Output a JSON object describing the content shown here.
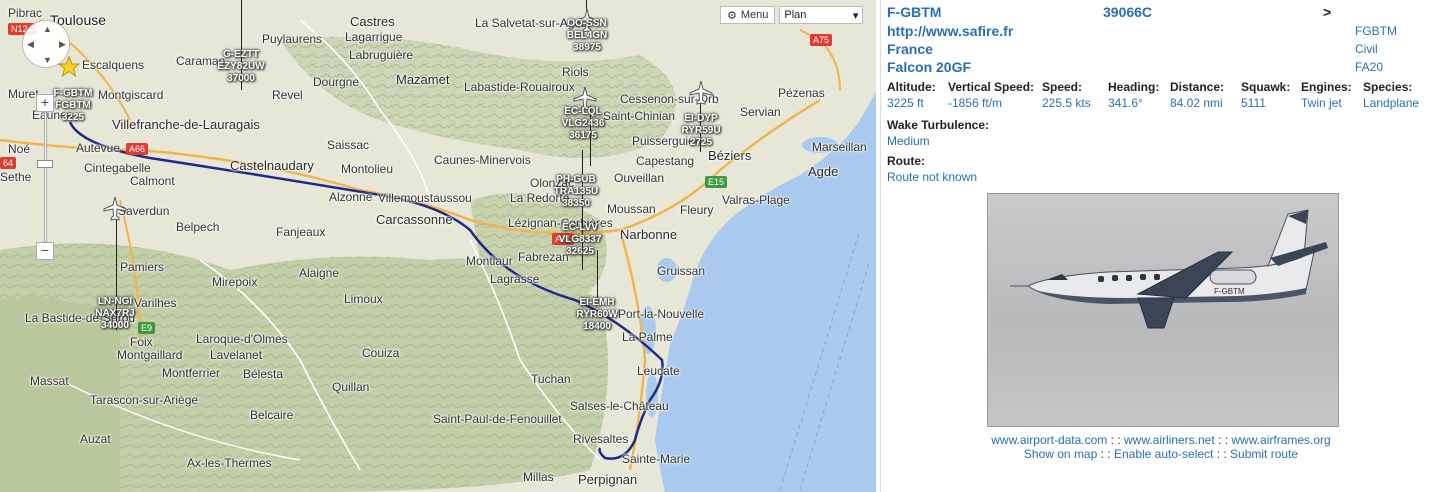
{
  "map": {
    "menu_label": "Menu",
    "menu_icon": "gear-icon",
    "map_type_value": "Plan",
    "zoom_in_label": "+",
    "zoom_out_label": "−",
    "places": [
      {
        "id": "toulouse",
        "name": "Toulouse",
        "size": "big"
      },
      {
        "id": "pibrac",
        "name": "Pibrac",
        "size": "small"
      },
      {
        "id": "castres",
        "name": "Castres",
        "size": "mid"
      },
      {
        "id": "lasalvetat",
        "name": "La Salvetat-sur-Agout",
        "size": "small"
      },
      {
        "id": "puylaurens",
        "name": "Puylaurens",
        "size": "small"
      },
      {
        "id": "lagarrigue",
        "name": "Lagarrigue",
        "size": "small"
      },
      {
        "id": "labruguiere",
        "name": "Labruguière",
        "size": "small"
      },
      {
        "id": "escalquens",
        "name": "Escalquens",
        "size": "small"
      },
      {
        "id": "caraman",
        "name": "Caraman",
        "size": "small"
      },
      {
        "id": "montgiscard",
        "name": "Montgiscard",
        "size": "small"
      },
      {
        "id": "revel",
        "name": "Revel",
        "size": "small"
      },
      {
        "id": "dourgne",
        "name": "Dourgne",
        "size": "small"
      },
      {
        "id": "mazamet",
        "name": "Mazamet",
        "size": "mid"
      },
      {
        "id": "labastide",
        "name": "Labastide-Rouairoux",
        "size": "small"
      },
      {
        "id": "riols",
        "name": "Riols",
        "size": "small"
      },
      {
        "id": "cessenon",
        "name": "Cessenon-sur-Orb",
        "size": "small"
      },
      {
        "id": "servian",
        "name": "Servian",
        "size": "small"
      },
      {
        "id": "pezenas",
        "name": "Pézenas",
        "size": "small"
      },
      {
        "id": "villefranche",
        "name": "Villefranche-de-Lauragais",
        "size": "mid"
      },
      {
        "id": "saintchinian",
        "name": "Saint-Chinian",
        "size": "small"
      },
      {
        "id": "puisserguier",
        "name": "Puisserguier",
        "size": "small"
      },
      {
        "id": "beziers",
        "name": "Béziers",
        "size": "mid"
      },
      {
        "id": "saissac",
        "name": "Saissac",
        "size": "small"
      },
      {
        "id": "caunes",
        "name": "Caunes-Minervois",
        "size": "small"
      },
      {
        "id": "capestang",
        "name": "Capestang",
        "size": "small"
      },
      {
        "id": "marseillan",
        "name": "Marseillan",
        "size": "small"
      },
      {
        "id": "castelnaudary",
        "name": "Castelnaudary",
        "size": "mid"
      },
      {
        "id": "montolieu",
        "name": "Montolieu",
        "size": "small"
      },
      {
        "id": "autevue",
        "name": "Autevue",
        "size": "small"
      },
      {
        "id": "cintegabelle",
        "name": "Cintegabelle",
        "size": "small"
      },
      {
        "id": "calmont",
        "name": "Calmont",
        "size": "small"
      },
      {
        "id": "olonzac",
        "name": "Olonzac",
        "size": "small"
      },
      {
        "id": "ouveillan",
        "name": "Ouveillan",
        "size": "small"
      },
      {
        "id": "agde",
        "name": "Agde",
        "size": "mid"
      },
      {
        "id": "alzonne",
        "name": "Alzonne",
        "size": "small"
      },
      {
        "id": "villemoustaussou",
        "name": "Villemoustaussou",
        "size": "small"
      },
      {
        "id": "laredorte",
        "name": "La Redorte",
        "size": "small"
      },
      {
        "id": "valras",
        "name": "Valras-Plage",
        "size": "small"
      },
      {
        "id": "saverdun",
        "name": "Saverdun",
        "size": "small"
      },
      {
        "id": "carcassonne",
        "name": "Carcassonne",
        "size": "mid"
      },
      {
        "id": "lezignan",
        "name": "Lézignan-Corbières",
        "size": "small"
      },
      {
        "id": "fleury",
        "name": "Fleury",
        "size": "small"
      },
      {
        "id": "belpech",
        "name": "Belpech",
        "size": "small"
      },
      {
        "id": "fanjeaux",
        "name": "Fanjeaux",
        "size": "small"
      },
      {
        "id": "moussan",
        "name": "Moussan",
        "size": "small"
      },
      {
        "id": "narbonne",
        "name": "Narbonne",
        "size": "mid"
      },
      {
        "id": "montlaur",
        "name": "Montlaur",
        "size": "small"
      },
      {
        "id": "fabrezan",
        "name": "Fabrezan",
        "size": "small"
      },
      {
        "id": "gruissan",
        "name": "Gruissan",
        "size": "small"
      },
      {
        "id": "pamiers",
        "name": "Pamiers",
        "size": "small"
      },
      {
        "id": "mirepoix",
        "name": "Mirepoix",
        "size": "small"
      },
      {
        "id": "alaigne",
        "name": "Alaigne",
        "size": "small"
      },
      {
        "id": "lagrasse",
        "name": "Lagrasse",
        "size": "small"
      },
      {
        "id": "limoux",
        "name": "Limoux",
        "size": "small"
      },
      {
        "id": "portlanouvelle",
        "name": "Port-la-Nouvelle",
        "size": "small"
      },
      {
        "id": "labastidedeser",
        "name": "La Bastide-de-Sérou",
        "size": "small"
      },
      {
        "id": "varilhes",
        "name": "Varilhes",
        "size": "small"
      },
      {
        "id": "foix",
        "name": "Foix",
        "size": "small"
      },
      {
        "id": "laroque",
        "name": "Laroque-d'Olmes",
        "size": "small"
      },
      {
        "id": "lapalme",
        "name": "La Palme",
        "size": "small"
      },
      {
        "id": "montgaillard",
        "name": "Montgaillard",
        "size": "small"
      },
      {
        "id": "lavelanet",
        "name": "Lavelanet",
        "size": "small"
      },
      {
        "id": "couiza",
        "name": "Couiza",
        "size": "small"
      },
      {
        "id": "massat",
        "name": "Massat",
        "size": "small"
      },
      {
        "id": "montferrier",
        "name": "Montferrier",
        "size": "small"
      },
      {
        "id": "belesta",
        "name": "Bélesta",
        "size": "small"
      },
      {
        "id": "leucate",
        "name": "Leucate",
        "size": "small"
      },
      {
        "id": "tarascon",
        "name": "Tarascon-sur-Ariège",
        "size": "small"
      },
      {
        "id": "quillan",
        "name": "Quillan",
        "size": "small"
      },
      {
        "id": "tuchan",
        "name": "Tuchan",
        "size": "small"
      },
      {
        "id": "salses",
        "name": "Salses-le-Château",
        "size": "small"
      },
      {
        "id": "belcaire",
        "name": "Belcaire",
        "size": "small"
      },
      {
        "id": "saintpaul",
        "name": "Saint-Paul-de-Fenouillet",
        "size": "small"
      },
      {
        "id": "auzat",
        "name": "Auzat",
        "size": "small"
      },
      {
        "id": "rivesaltes",
        "name": "Rivesaltes",
        "size": "small"
      },
      {
        "id": "axlesthermes",
        "name": "Ax-les-Thermes",
        "size": "small"
      },
      {
        "id": "saintemarie",
        "name": "Sainte-Marie",
        "size": "small"
      },
      {
        "id": "millas",
        "name": "Millas",
        "size": "small"
      },
      {
        "id": "perpignan",
        "name": "Perpignan",
        "size": "mid"
      },
      {
        "id": "muret",
        "name": "Muret",
        "size": "small"
      },
      {
        "id": "eaunes",
        "name": "Eaunes",
        "size": "small"
      },
      {
        "id": "noe",
        "name": "Noé",
        "size": "small"
      },
      {
        "id": "sethe",
        "name": "Sethe",
        "size": "small"
      }
    ],
    "roads": [
      {
        "id": "n124",
        "label": "N124",
        "color": "#e23b30"
      },
      {
        "id": "a75",
        "label": "A75",
        "color": "#e23b30"
      },
      {
        "id": "a66",
        "label": "A66",
        "color": "#e23b30"
      },
      {
        "id": "a61",
        "label": "A61",
        "color": "#e23b30"
      },
      {
        "id": "e15",
        "label": "E15",
        "color": "#3f9a3f"
      },
      {
        "id": "e9",
        "label": "E9",
        "color": "#3f9a3f"
      },
      {
        "id": "a64",
        "label": "64",
        "color": "#e23b30"
      }
    ],
    "aircraft": [
      {
        "id": "fgbtm",
        "lines": [
          "F-GBTM",
          "FGBTM",
          "3225"
        ]
      },
      {
        "id": "gezt",
        "lines": [
          "G-EZTT",
          "EZY82UW",
          "37000"
        ]
      },
      {
        "id": "oossn",
        "lines": [
          "OO-SSN",
          "BEL4GN",
          "38975"
        ]
      },
      {
        "id": "eclql",
        "lines": [
          "EC-LQL",
          "VLG2436",
          "36175"
        ]
      },
      {
        "id": "eidyp",
        "lines": [
          "EI-DYP",
          "RYR59U",
          "2725"
        ]
      },
      {
        "id": "phgub",
        "lines": [
          "PH-GUB",
          "TRA135U",
          "38350"
        ]
      },
      {
        "id": "eclvv",
        "lines": [
          "EC-LVV",
          "VLG8337",
          "32625"
        ]
      },
      {
        "id": "eiemh",
        "lines": [
          "EI-EMH",
          "RYR60W",
          "18400"
        ]
      },
      {
        "id": "lnngl",
        "lines": [
          "LN-NGI",
          "NAX7RJ",
          "34000"
        ]
      }
    ]
  },
  "panel": {
    "registration": "F-GBTM",
    "icao_hex": "39066C",
    "nav_arrow": ">",
    "website": "http://www.safire.fr",
    "callsign": "FGBTM",
    "country": "France",
    "category": "Civil",
    "aircraft_type": "Falcon 20GF",
    "type_code": "FA20",
    "stats": [
      {
        "label": "Altitude:",
        "value": "3225 ft"
      },
      {
        "label": "Vertical Speed:",
        "value": "-1856 ft/m"
      },
      {
        "label": "Speed:",
        "value": "225.5 kts"
      },
      {
        "label": "Heading:",
        "value": "341.6°"
      },
      {
        "label": "Distance:",
        "value": "84.02 nmi"
      },
      {
        "label": "Squawk:",
        "value": "5111"
      },
      {
        "label": "Engines:",
        "value": "Twin jet"
      },
      {
        "label": "Species:",
        "value": "Landplane"
      }
    ],
    "wake_label": "Wake Turbulence:",
    "wake_value": "Medium",
    "route_label": "Route:",
    "route_value": "Route not known",
    "links1": [
      "www.airport-data.com",
      "www.airliners.net",
      "www.airframes.org"
    ],
    "links2": [
      "Show on map",
      "Enable auto-select",
      "Submit route"
    ],
    "separator": " : : ",
    "airplane_reg_on_photo": "F-GBTM"
  }
}
